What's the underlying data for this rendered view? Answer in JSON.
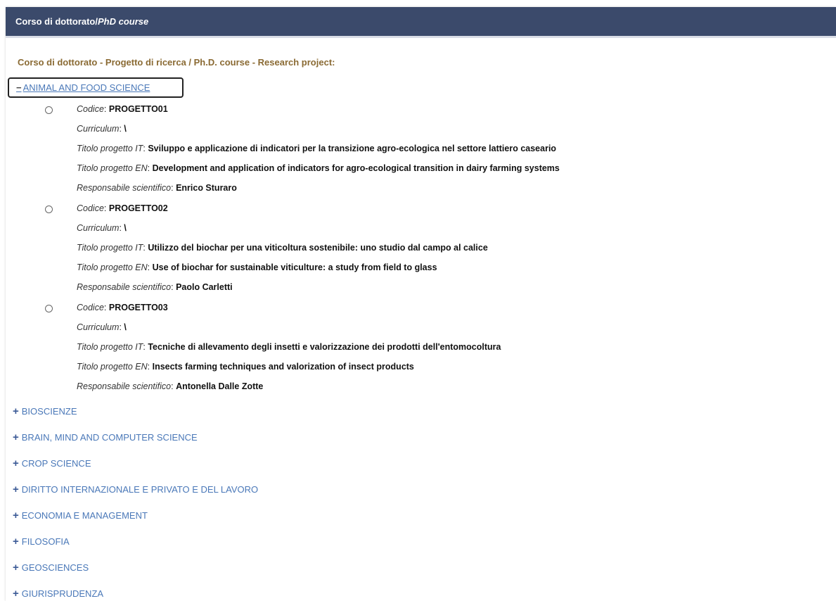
{
  "header": {
    "title_main": "Corso di dottorato/",
    "title_italic": "PhD course"
  },
  "section_label": "Corso di dottorato - Progetto di ricerca / Ph.D. course - Research project:",
  "open_category": {
    "sign": "−",
    "label": "ANIMAL AND FOOD SCIENCE"
  },
  "field_labels": {
    "code": "Codice",
    "curriculum": "Curriculum",
    "title_it": "Titolo progetto IT",
    "title_en": "Titolo progetto EN",
    "responsible": "Responsabile scientifico"
  },
  "projects": [
    {
      "code": "PROGETTO01",
      "curriculum": "\\",
      "title_it": "Sviluppo e applicazione di indicatori per la transizione agro-ecologica nel settore lattiero caseario",
      "title_en": "Development and application of indicators for agro-ecological transition in dairy farming systems",
      "responsible": "Enrico Sturaro"
    },
    {
      "code": "PROGETTO02",
      "curriculum": "\\",
      "title_it": "Utilizzo del biochar per una viticoltura sostenibile: uno studio dal campo al calice",
      "title_en": "Use of biochar for sustainable viticulture: a study from field to glass",
      "responsible": "Paolo Carletti"
    },
    {
      "code": "PROGETTO03",
      "curriculum": "\\",
      "title_it": "Tecniche di allevamento degli insetti e valorizzazione dei prodotti dell'entomocoltura",
      "title_en": "Insects farming techniques and valorization of insect products",
      "responsible": "Antonella Dalle Zotte"
    }
  ],
  "collapsed_categories": [
    "BIOSCIENZE",
    "BRAIN, MIND AND COMPUTER SCIENCE",
    "CROP SCIENCE",
    "DIRITTO INTERNAZIONALE E PRIVATO E DEL LAVORO",
    "ECONOMIA E MANAGEMENT",
    "FILOSOFIA",
    "GEOSCIENCES",
    "GIURISPRUDENZA"
  ],
  "icons": {
    "expand": "plus-icon",
    "collapse": "minus-icon",
    "select": "radio-icon"
  },
  "colors": {
    "header_bg": "#3b4a6b",
    "link": "#4a78b8",
    "section_label": "#8a6a33"
  }
}
